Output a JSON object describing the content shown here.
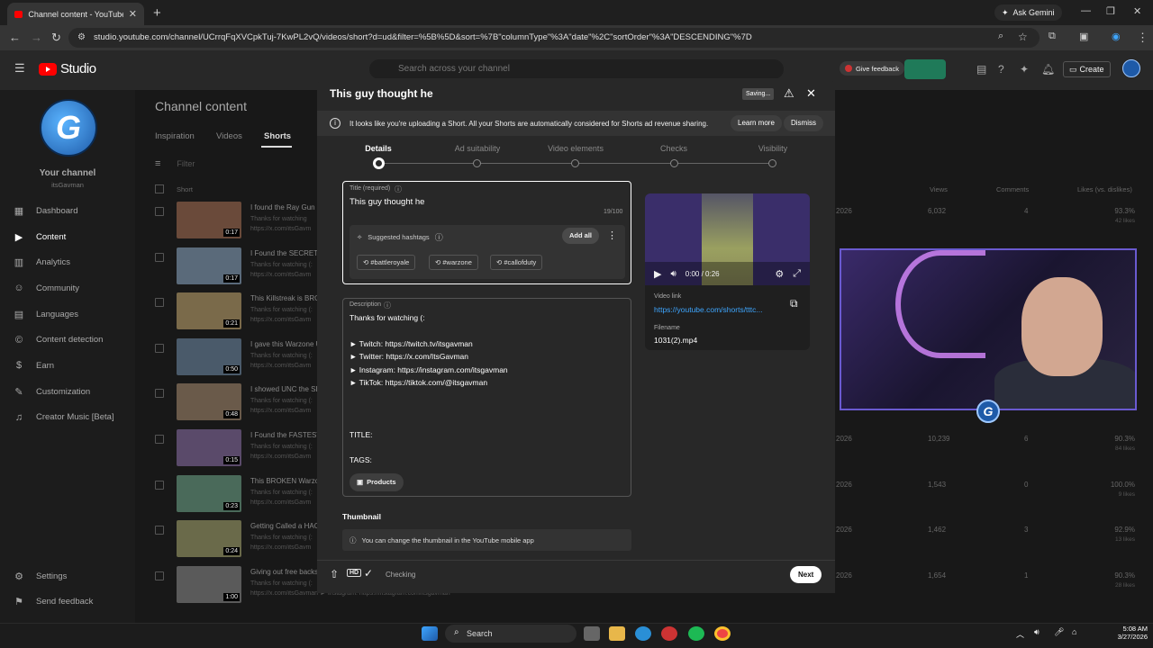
{
  "browser": {
    "tab_title": "Channel content - YouTube Stu...",
    "url": "studio.youtube.com/channel/UCrrqFqXVCpkTuj-7KwPL2vQ/videos/short?d=ud&filter=%5B%5D&sort=%7B\"columnType\"%3A\"date\"%2C\"sortOrder\"%3A\"DESCENDING\"%7D",
    "ask_gemini": "Ask Gemini"
  },
  "studio": {
    "logo": "Studio",
    "search_placeholder": "Search across your channel",
    "feedback": "Give feedback",
    "create": "Create"
  },
  "sidebar": {
    "your_channel": "Your channel",
    "handle": "itsGavman",
    "items": [
      {
        "label": "Dashboard",
        "icon": "dashboard-icon"
      },
      {
        "label": "Content",
        "icon": "content-icon"
      },
      {
        "label": "Analytics",
        "icon": "analytics-icon"
      },
      {
        "label": "Community",
        "icon": "community-icon"
      },
      {
        "label": "Languages",
        "icon": "languages-icon"
      },
      {
        "label": "Content detection",
        "icon": "content-detection-icon"
      },
      {
        "label": "Earn",
        "icon": "earn-icon"
      },
      {
        "label": "Customization",
        "icon": "customization-icon"
      },
      {
        "label": "Creator Music [Beta]",
        "icon": "creator-music-icon"
      }
    ],
    "settings": "Settings",
    "send_feedback": "Send feedback"
  },
  "content": {
    "title": "Channel content",
    "tabs": [
      "Inspiration",
      "Videos",
      "Shorts"
    ],
    "filter": "Filter",
    "col_short": "Short",
    "col_views": "Views",
    "col_comments": "Comments",
    "col_likes": "Likes (vs. dislikes)",
    "rows": [
      {
        "title": "I found the Ray Gun i",
        "desc": "Thanks for watching",
        "url": "https://x.com/itsGavm",
        "duration": "0:17",
        "date": "2026",
        "views": "6,032",
        "comments": "4",
        "likes": "93.3%",
        "likes_sub": "42 likes"
      },
      {
        "title": "I Found the SECRET A",
        "desc": "Thanks for watching (:",
        "url": "https://x.com/itsGavm",
        "duration": "0:17",
        "date": "",
        "views": "",
        "comments": "",
        "likes": "",
        "likes_sub": ""
      },
      {
        "title": "This Killstreak is BRO",
        "desc": "Thanks for watching (:",
        "url": "https://x.com/itsGavm",
        "duration": "0:21",
        "date": "",
        "views": "",
        "comments": "",
        "likes": "",
        "likes_sub": ""
      },
      {
        "title": "I gave this Warzone U",
        "desc": "Thanks for watching (:",
        "url": "https://x.com/itsGavm",
        "duration": "0:50",
        "date": "",
        "views": "",
        "comments": "",
        "likes": "",
        "likes_sub": ""
      },
      {
        "title": "I showed UNC the SE",
        "desc": "Thanks for watching (:",
        "url": "https://x.com/itsGavm",
        "duration": "0:48",
        "date": "",
        "views": "",
        "comments": "",
        "likes": "",
        "likes_sub": ""
      },
      {
        "title": "I Found the FASTEST",
        "desc": "Thanks for watching (:",
        "url": "https://x.com/itsGavm",
        "duration": "0:15",
        "date": "2026",
        "views": "10,239",
        "comments": "6",
        "likes": "90.3%",
        "likes_sub": "84 likes"
      },
      {
        "title": "This BROKEN Warzo",
        "desc": "Thanks for watching (:",
        "url": "https://x.com/itsGavm",
        "duration": "0:23",
        "date": "2026",
        "views": "1,543",
        "comments": "0",
        "likes": "100.0%",
        "likes_sub": "9 likes"
      },
      {
        "title": "Getting Called a HAC",
        "desc": "Thanks for watching (:",
        "url": "https://x.com/itsGavm",
        "duration": "0:24",
        "date": "2026",
        "views": "1,462",
        "comments": "3",
        "likes": "92.9%",
        "likes_sub": "13 likes"
      },
      {
        "title": "Giving out free backs",
        "desc": "Thanks for watching (:",
        "url": "https://x.com/itsGavman ► Instagram: https://instagram.com/itsgavman",
        "duration": "1:00",
        "date": "2026",
        "views": "1,654",
        "comments": "1",
        "likes": "90.3%",
        "likes_sub": "28 likes"
      }
    ]
  },
  "dialog": {
    "title": "This guy thought he",
    "saving": "Saving...",
    "info": "It looks like you're uploading a Short. All your Shorts are automatically considered for Shorts ad revenue sharing.",
    "learn_more": "Learn more",
    "dismiss": "Dismiss",
    "steps": [
      "Details",
      "Ad suitability",
      "Video elements",
      "Checks",
      "Visibility"
    ],
    "title_label": "Title (required)",
    "title_value": "This guy thought he",
    "title_count": "19/100",
    "suggested_hashtags": "Suggested hashtags",
    "add_all": "Add all",
    "hashtags": [
      "#battleroyale",
      "#warzone",
      "#callofduty"
    ],
    "description_label": "Description",
    "description_lines": [
      "Thanks for watching (:",
      "",
      "► Twitch:  https://twitch.tv/itsgavman",
      "► Twitter:   https://x.com/ItsGavman",
      "► Instagram: https://instagram.com/itsgavman",
      "► TikTok:  https://tiktok.com/@itsgavman",
      "",
      "",
      "",
      "TITLE:",
      "",
      "TAGS:"
    ],
    "products": "Products",
    "thumbnail_heading": "Thumbnail",
    "thumbnail_info": "You can change the thumbnail in the YouTube mobile app",
    "video_time": "0:00 / 0:26",
    "video_link_label": "Video link",
    "video_link": "https://youtube.com/shorts/tttc...",
    "filename_label": "Filename",
    "filename": "1031(2).mp4",
    "checking": "Checking",
    "next": "Next",
    "hd": "HD"
  },
  "taskbar": {
    "search": "Search",
    "time": "5:08 AM",
    "date": "3/27/2026"
  },
  "colors": {
    "accent": "#3ea6ff",
    "youtube_red": "#ff0000",
    "green_button": "#1f7a59"
  }
}
